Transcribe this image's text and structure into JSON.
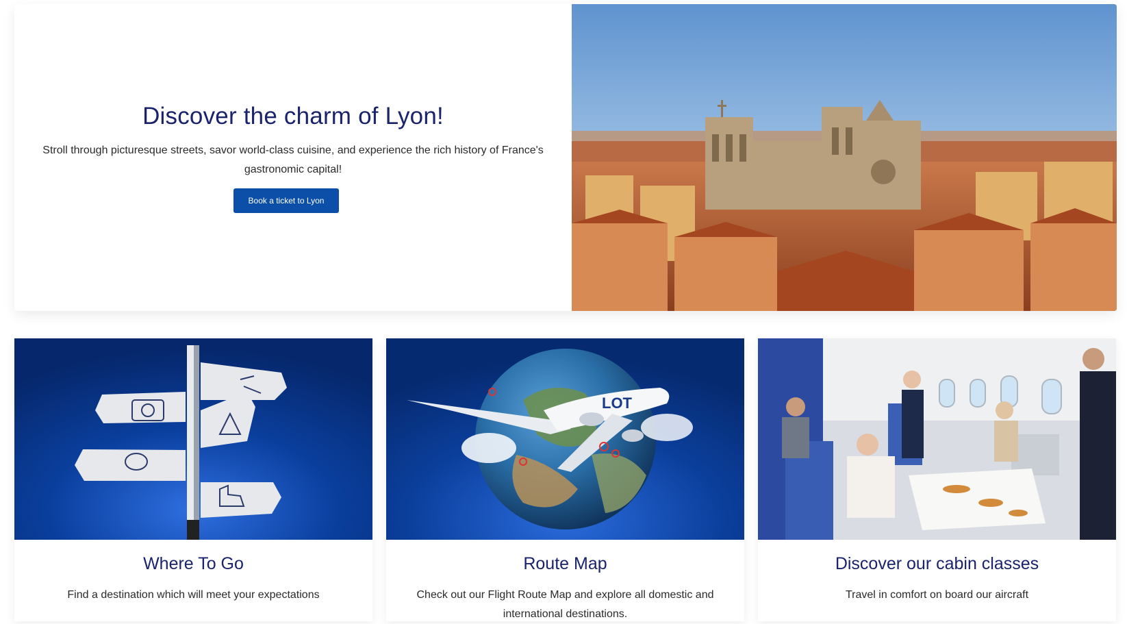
{
  "hero": {
    "title": "Discover the charm of Lyon!",
    "description": "Stroll through picturesque streets, savor world-class cuisine, and experience the rich history of France's gastronomic capital!",
    "button_label": "Book a ticket to Lyon"
  },
  "cards": [
    {
      "title": "Where To Go",
      "description": "Find a destination which will meet your expectations"
    },
    {
      "title": "Route Map",
      "description": "Check out our Flight Route Map and explore all domestic and international destinations."
    },
    {
      "title": "Discover our cabin classes",
      "description": "Travel in comfort on board our aircraft"
    }
  ],
  "images": {
    "plane_logo_text": "LOT"
  },
  "colors": {
    "heading": "#1a236b",
    "button": "#0b4fa8",
    "card_blue": "#0a3f9e"
  }
}
